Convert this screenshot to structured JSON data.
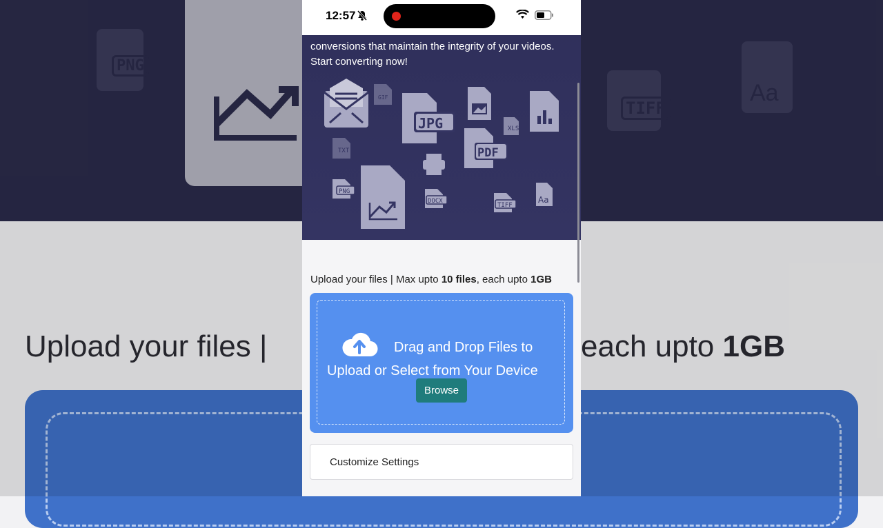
{
  "status_bar": {
    "time": "12:57"
  },
  "hero": {
    "line1": "conversions that maintain the integrity of your videos.",
    "line2": "Start converting now!",
    "icons": [
      "mail-icon",
      "gif-file-icon",
      "jpg-file-icon",
      "image-file-icon",
      "bar-chart-file-icon",
      "xls-file-icon",
      "txt-file-icon",
      "pdf-file-icon",
      "printer-icon",
      "png-file-icon",
      "chart-file-icon",
      "docx-file-icon",
      "tiff-file-icon",
      "font-file-icon"
    ]
  },
  "upload": {
    "caption_prefix": "Upload your files | Max upto ",
    "caption_files": "10 files",
    "caption_mid": ", each upto ",
    "caption_size": "1GB",
    "drop_line1": "Drag and Drop Files to",
    "drop_line2": "Upload or Select from Your Device",
    "browse_label": "Browse"
  },
  "settings": {
    "label": "Customize Settings"
  },
  "background": {
    "heading_left": "Upload your files |",
    "heading_right_prefix": "each upto ",
    "heading_right_bold": "1GB",
    "doc_labels": [
      "PNG",
      "TIFF",
      "Aa"
    ]
  },
  "colors": {
    "hero_bg": "#2f2f5a",
    "dropzone_bg": "#5590ef",
    "browse_bg": "#1f7c7c",
    "recording_dot": "#e0241b"
  }
}
